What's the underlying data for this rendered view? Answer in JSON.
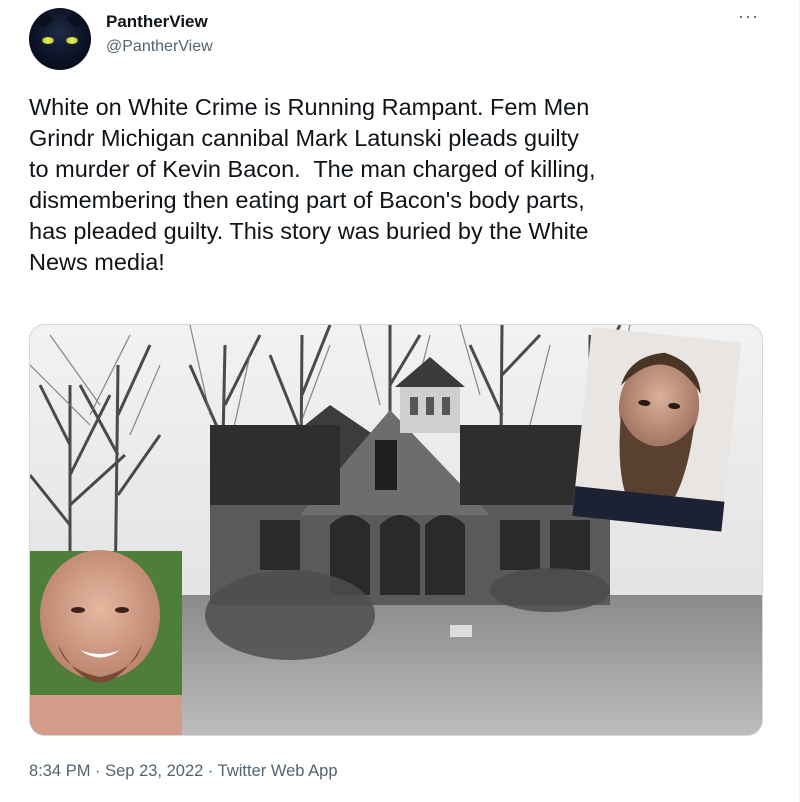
{
  "author": {
    "display_name": "PantherView",
    "handle": "@PantherView"
  },
  "more_glyph": "···",
  "tweet": {
    "text": "White on White Crime is Running Rampant. Fem Men\nGrindr Michigan cannibal Mark Latunski pleads guilty\nto murder of Kevin Bacon.  The man charged of killing,\ndismembering then eating part of Bacon's body parts,\nhas pleaded guilty. This story was buried by the White\nNews media!"
  },
  "meta": {
    "time": "8:34 PM",
    "separator1": " · ",
    "date": "Sep 23, 2022",
    "separator2": " · ",
    "source": "Twitter Web App"
  },
  "media": {
    "icons": [
      "house-photo",
      "bearded-man-photo",
      "smiling-man-photo"
    ]
  }
}
